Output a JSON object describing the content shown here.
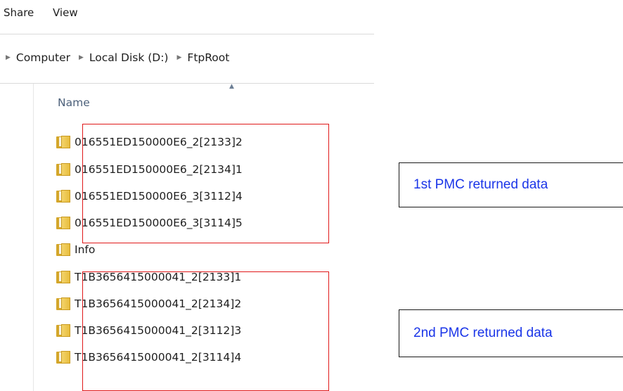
{
  "ribbon": {
    "tabs": [
      "Share",
      "View"
    ]
  },
  "breadcrumb": [
    "Computer",
    "Local Disk (D:)",
    "FtpRoot"
  ],
  "column_header": "Name",
  "files": [
    {
      "name": "016551ED150000E6_2[2133]2"
    },
    {
      "name": "016551ED150000E6_2[2134]1"
    },
    {
      "name": "016551ED150000E6_3[3112]4"
    },
    {
      "name": "016551ED150000E6_3[3114]5"
    },
    {
      "name": "Info"
    },
    {
      "name": "T1B3656415000041_2[2133]1"
    },
    {
      "name": "T1B3656415000041_2[2134]2"
    },
    {
      "name": "T1B3656415000041_2[3112]3"
    },
    {
      "name": "T1B3656415000041_2[3114]4"
    }
  ],
  "annotations": [
    {
      "text": "1st PMC returned data"
    },
    {
      "text": "2nd PMC returned data"
    }
  ],
  "colors": {
    "highlight_border": "#e0191a",
    "annotation_text": "#1a35e8"
  }
}
